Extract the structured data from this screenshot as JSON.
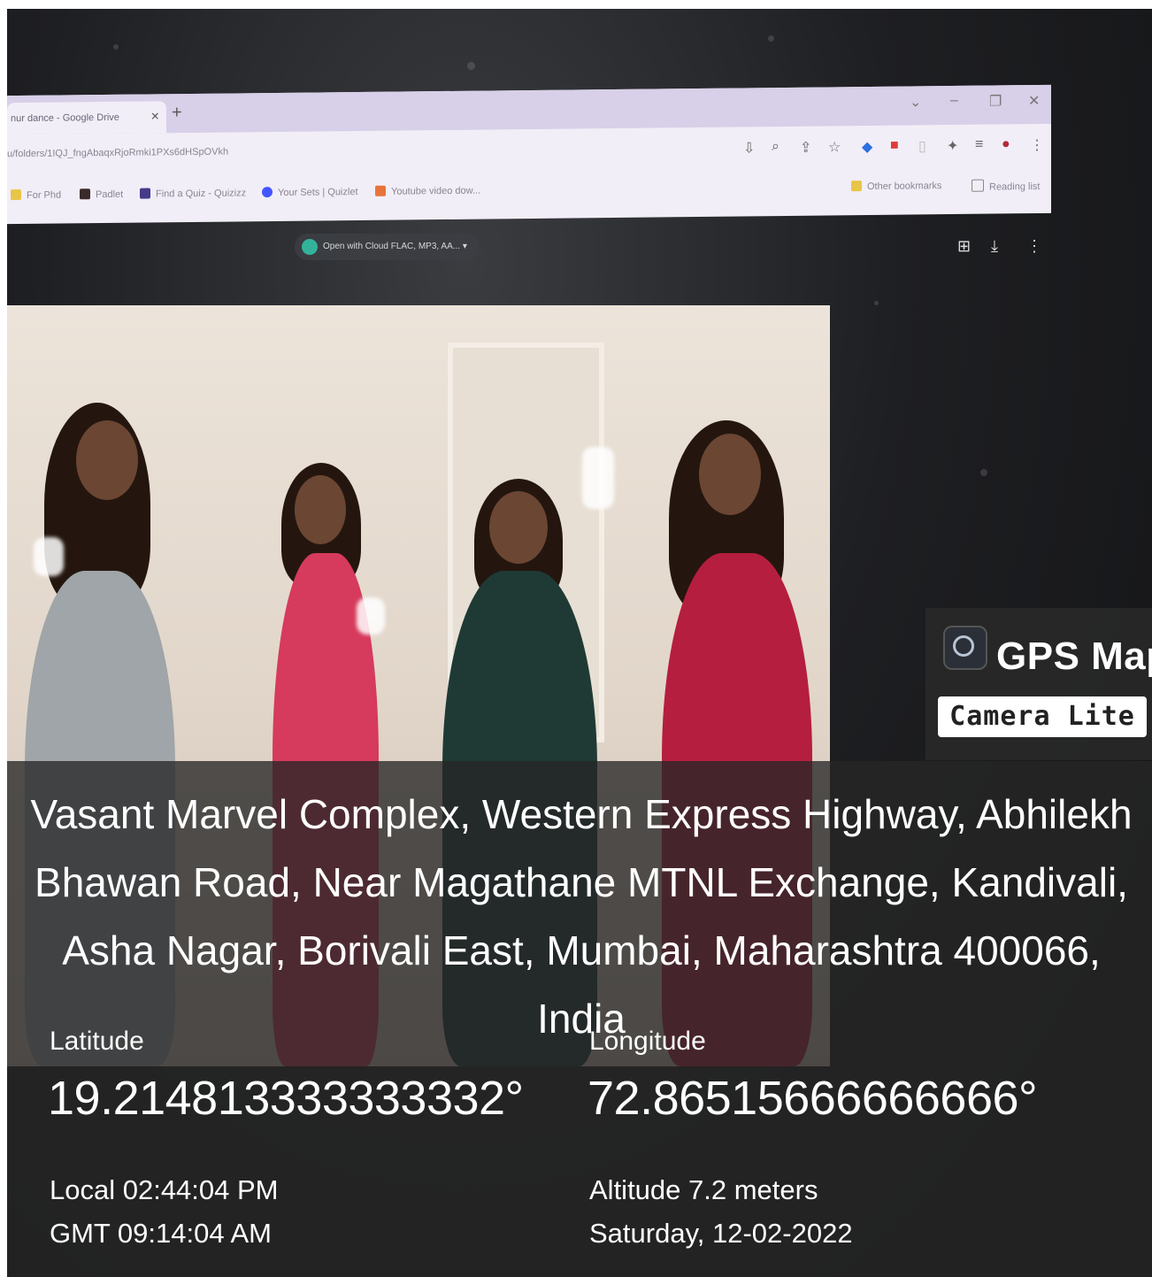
{
  "browser": {
    "tab_title": "nur dance - Google Drive",
    "new_tab": "+",
    "tab_close": "×",
    "url": "u/folders/1IQJ_fngAbaqxRjoRmki1PXs6dHSpOVkh",
    "bookmarks": [
      "For Phd",
      "Padlet",
      "Find a Quiz - Quizizz",
      "Your Sets | Quizlet",
      "Youtube video dow..."
    ],
    "other_bookmarks": "Other bookmarks",
    "reading_list": "Reading list"
  },
  "drive": {
    "open_with": "Open with Cloud FLAC, MP3, AA..."
  },
  "gps_badge": {
    "title": "GPS Map",
    "subtitle": "Camera Lite"
  },
  "location": {
    "address": "Vasant Marvel Complex, Western Express Highway, Abhilekh Bhawan Road, Near Magathane MTNL Exchange, Kandivali, Asha Nagar, Borivali East, Mumbai, Maharashtra 400066, India",
    "latitude_label": "Latitude",
    "latitude": "19.214813333333332°",
    "longitude_label": "Longitude",
    "longitude": "72.86515666666666°",
    "local_time": "Local 02:44:04 PM",
    "gmt_time": "GMT 09:14:04 AM",
    "altitude": "Altitude 7.2 meters",
    "date": "Saturday, 12-02-2022"
  },
  "colors": {
    "overlay": "#262626",
    "badge_bg": "#282828",
    "text": "#ffffff",
    "tab_bar": "#d8cfe8"
  }
}
